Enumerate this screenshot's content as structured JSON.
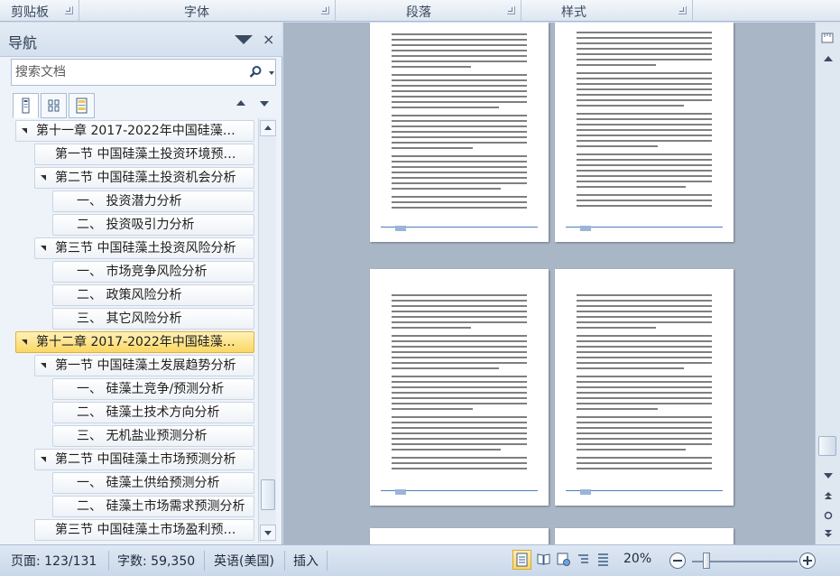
{
  "ribbon": {
    "groups": [
      {
        "label": "剪贴板"
      },
      {
        "label": "字体"
      },
      {
        "label": "段落"
      },
      {
        "label": "样式"
      }
    ]
  },
  "nav": {
    "title": "导航",
    "close_label": "×",
    "search_placeholder": "搜索文档",
    "items": [
      {
        "text": "第十一章 2017-2022年中国硅藻…",
        "level": 0,
        "expanded": true,
        "selected": false
      },
      {
        "text": "第一节 中国硅藻土投资环境预…",
        "level": 1,
        "expanded": false,
        "selected": false
      },
      {
        "text": "第二节 中国硅藻土投资机会分析",
        "level": 1,
        "expanded": true,
        "selected": false
      },
      {
        "text": "一、 投资潜力分析",
        "level": 2,
        "expanded": false,
        "selected": false
      },
      {
        "text": "二、 投资吸引力分析",
        "level": 2,
        "expanded": false,
        "selected": false
      },
      {
        "text": "第三节 中国硅藻土投资风险分析",
        "level": 1,
        "expanded": true,
        "selected": false
      },
      {
        "text": "一、 市场竞争风险分析",
        "level": 2,
        "expanded": false,
        "selected": false
      },
      {
        "text": "二、 政策风险分析",
        "level": 2,
        "expanded": false,
        "selected": false
      },
      {
        "text": "三、 其它风险分析",
        "level": 2,
        "expanded": false,
        "selected": false
      },
      {
        "text": "第十二章 2017-2022年中国硅藻…",
        "level": 0,
        "expanded": true,
        "selected": true
      },
      {
        "text": "第一节 中国硅藻土发展趋势分析",
        "level": 1,
        "expanded": true,
        "selected": false
      },
      {
        "text": "一、 硅藻土竞争/预测分析",
        "level": 2,
        "expanded": false,
        "selected": false
      },
      {
        "text": "二、 硅藻土技术方向分析",
        "level": 2,
        "expanded": false,
        "selected": false
      },
      {
        "text": "三、 无机盐业预测分析",
        "level": 2,
        "expanded": false,
        "selected": false
      },
      {
        "text": "第二节 中国硅藻土市场预测分析",
        "level": 1,
        "expanded": true,
        "selected": false
      },
      {
        "text": "一、 硅藻土供给预测分析",
        "level": 2,
        "expanded": false,
        "selected": false
      },
      {
        "text": "二、 硅藻土市场需求预测分析",
        "level": 2,
        "expanded": false,
        "selected": false
      },
      {
        "text": "第三节 中国硅藻土市场盈利预…",
        "level": 1,
        "expanded": false,
        "selected": false
      }
    ]
  },
  "status": {
    "page": "页面: 123/131",
    "words": "字数: 59,350",
    "language": "英语(美国)",
    "mode": "插入",
    "zoom": "20%",
    "zoom_fraction": 0.1
  },
  "colors": {
    "selected_bg": "#fbd764",
    "accent": "#4a7fc4"
  }
}
